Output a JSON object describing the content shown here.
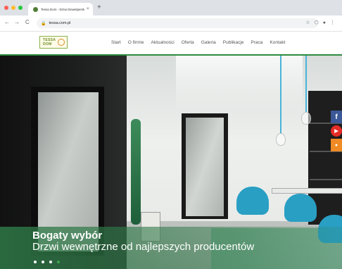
{
  "browser": {
    "tab_title": "Tessa Dom - Drzwi Dewelperskie",
    "tab_close": "×",
    "new_tab": "+",
    "url": "tessa.com.pl",
    "nav_back": "←",
    "nav_forward": "→",
    "nav_reload": "C",
    "lock_glyph": "🔒",
    "icons": [
      "star-icon",
      "extensions-icon",
      "profile-icon",
      "menu-icon"
    ],
    "icon_glyphs": [
      "☆",
      "⬡",
      "●",
      "⋮"
    ],
    "light_colors": [
      "#ff5f57",
      "#febc2e",
      "#28c840"
    ]
  },
  "site": {
    "logo_line1": "TESSA",
    "logo_line2": "DOM",
    "nav": [
      "Start",
      "O firmie",
      "Aktualności",
      "Oferta",
      "Galeria",
      "Publikacje",
      "Praca",
      "Kontakt"
    ],
    "accent_color": "#2e8b3e"
  },
  "hero": {
    "title": "Bogaty wybór",
    "subtitle": "Drzwi wewnętrzne od najlepszych producentów",
    "slide_count": 4,
    "active_slide": 3
  },
  "social": [
    {
      "icon": "facebook-icon",
      "glyph": "f",
      "color": "#3b5998"
    },
    {
      "icon": "youtube-icon",
      "glyph": "▶",
      "color": "#e52d27"
    },
    {
      "icon": "other-social-icon",
      "glyph": "●",
      "color": "#f08a24"
    }
  ]
}
